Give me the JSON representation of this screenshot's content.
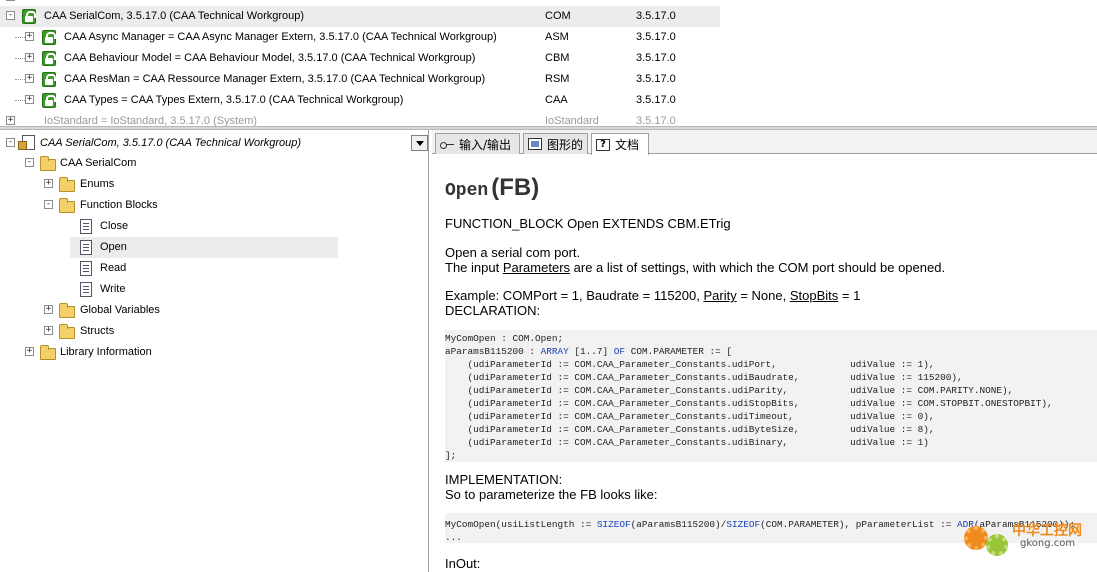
{
  "library_table": {
    "rows": [
      {
        "name": "",
        "namespace": "",
        "version": ""
      },
      {
        "name": "CAA SerialCom, 3.5.17.0 (CAA Technical Workgroup)",
        "namespace": "COM",
        "version": "3.5.17.0",
        "expander": "-"
      },
      {
        "name": "CAA Async Manager = CAA Async Manager Extern, 3.5.17.0 (CAA Technical Workgroup)",
        "namespace": "ASM",
        "version": "3.5.17.0",
        "expander": "+"
      },
      {
        "name": "CAA Behaviour Model = CAA Behaviour Model, 3.5.17.0 (CAA Technical Workgroup)",
        "namespace": "CBM",
        "version": "3.5.17.0",
        "expander": "+"
      },
      {
        "name": "CAA ResMan = CAA Ressource Manager Extern, 3.5.17.0 (CAA Technical Workgroup)",
        "namespace": "RSM",
        "version": "3.5.17.0",
        "expander": "+"
      },
      {
        "name": "CAA Types = CAA Types Extern, 3.5.17.0 (CAA Technical Workgroup)",
        "namespace": "CAA",
        "version": "3.5.17.0",
        "expander": "+"
      },
      {
        "name": "IoStandard = IoStandard, 3.5.17.0 (System)",
        "namespace": "IoStandard",
        "version": "3.5.17.0",
        "expander": "+"
      }
    ]
  },
  "tree": {
    "header_title": "CAA SerialCom, 3.5.17.0 (CAA Technical Workgroup)",
    "nodes": [
      {
        "label": "CAA SerialCom",
        "expander": "-"
      },
      {
        "label": "Enums",
        "expander": "+"
      },
      {
        "label": "Function Blocks",
        "expander": "-"
      },
      {
        "label": "Close"
      },
      {
        "label": "Open"
      },
      {
        "label": "Read"
      },
      {
        "label": "Write"
      },
      {
        "label": "Global Variables",
        "expander": "+"
      },
      {
        "label": "Structs",
        "expander": "+"
      },
      {
        "label": "Library Information",
        "expander": "+"
      }
    ]
  },
  "tabs": [
    {
      "label": "输入/输出",
      "icon": "io-icon"
    },
    {
      "label": "图形的",
      "icon": "graphic-icon"
    },
    {
      "label": "文档",
      "icon": "help-icon"
    }
  ],
  "doc": {
    "title_name": "Open",
    "title_kind": "(FB)",
    "signature": "FUNCTION_BLOCK Open EXTENDS CBM.ETrig",
    "desc_line1": "Open a serial com port.",
    "desc_line2_pre": "The input ",
    "desc_line2_link": "Parameters",
    "desc_line2_post": " are a list of settings, with which the COM port should be opened.",
    "example_pre": "Example: COMPort = 1, Baudrate = 115200, ",
    "example_link1": "Parity",
    "example_mid": " = None, ",
    "example_link2": "StopBits",
    "example_post": " = 1",
    "declaration_label": "DECLARATION:",
    "code1_l1": "MyComOpen : COM.Open;",
    "code1_l2a": "aParamsB115200 : ",
    "code1_l2kw1": "ARRAY",
    "code1_l2b": " [1..7] ",
    "code1_l2kw2": "OF",
    "code1_l2c": " COM.PARAMETER := [",
    "code1_l3": "    (udiParameterId := COM.CAA_Parameter_Constants.udiPort,             udiValue := 1),",
    "code1_l4": "    (udiParameterId := COM.CAA_Parameter_Constants.udiBaudrate,         udiValue := 115200),",
    "code1_l5": "    (udiParameterId := COM.CAA_Parameter_Constants.udiParity,           udiValue := COM.PARITY.NONE),",
    "code1_l6": "    (udiParameterId := COM.CAA_Parameter_Constants.udiStopBits,         udiValue := COM.STOPBIT.ONESTOPBIT),",
    "code1_l7": "    (udiParameterId := COM.CAA_Parameter_Constants.udiTimeout,          udiValue := 0),",
    "code1_l8": "    (udiParameterId := COM.CAA_Parameter_Constants.udiByteSize,         udiValue := 8),",
    "code1_l9": "    (udiParameterId := COM.CAA_Parameter_Constants.udiBinary,           udiValue := 1)",
    "code1_l10": "];",
    "implementation_label": "IMPLEMENTATION:",
    "implementation_text": "So to parameterize the FB looks like:",
    "code2_a": "MyComOpen(usiListLength := ",
    "code2_kw1": "SIZEOF",
    "code2_b": "(aParamsB115200)/",
    "code2_kw2": "SIZEOF",
    "code2_c": "(COM.PARAMETER), pParameterList := ",
    "code2_kw3": "ADR",
    "code2_d": "(aParamsB115200));",
    "code2_l2": "...",
    "inout_label": "InOut:"
  },
  "watermark": {
    "text": "中华工控网",
    "url": "gkong.com"
  }
}
